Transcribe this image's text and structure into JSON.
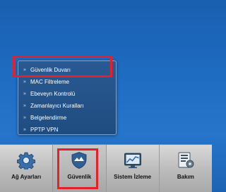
{
  "security_menu": {
    "items": [
      {
        "label": "Güvenlik Duvarı"
      },
      {
        "label": "MAC Filtreleme"
      },
      {
        "label": "Ebeveyn Kontrolü"
      },
      {
        "label": "Zamanlayıcı Kuralları"
      },
      {
        "label": "Belgelendirme"
      },
      {
        "label": "PPTP VPN"
      }
    ]
  },
  "toolbar": {
    "items": [
      {
        "label": "Ağ Ayarları",
        "icon": "gear-icon"
      },
      {
        "label": "Güvenlik",
        "icon": "shield-icon",
        "active": true
      },
      {
        "label": "Sistem İzleme",
        "icon": "monitor-chart-icon"
      },
      {
        "label": "Bakım",
        "icon": "maintenance-icon"
      }
    ]
  },
  "colors": {
    "highlight": "#e4202a",
    "desktop_blue": "#1f6ec4",
    "menu_bg": "#2a5a93"
  }
}
